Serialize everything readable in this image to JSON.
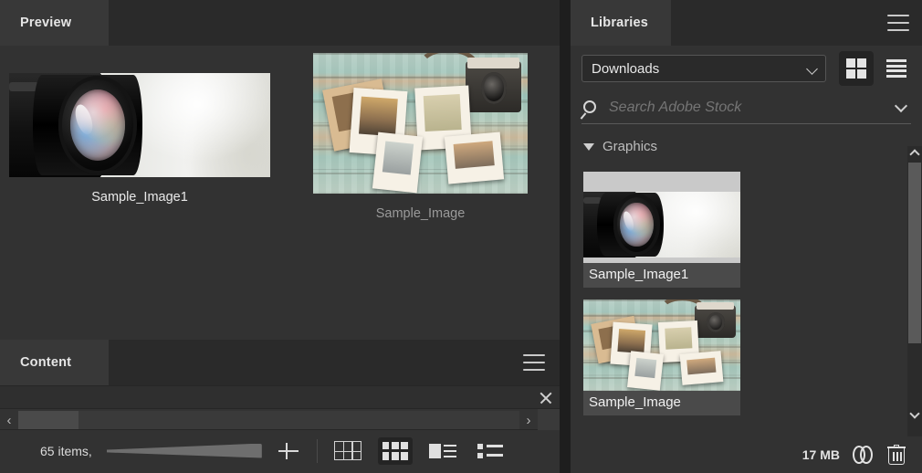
{
  "preview_panel": {
    "tab_label": "Preview",
    "menu_icon": "hamburger-menu-icon",
    "items": [
      {
        "caption": "Sample_Image1",
        "artwork": "camera-lens-photo"
      },
      {
        "caption": "Sample_Image",
        "artwork": "polaroid-photos-on-wood-photo"
      }
    ]
  },
  "content_panel": {
    "tab_label": "Content",
    "menu_icon": "hamburger-menu-icon",
    "close_icon": "close-icon",
    "scrollbar": {
      "left_arrow": "‹",
      "right_arrow": "›"
    },
    "toolbar": {
      "items_count": "65 items,",
      "zoom_slider_label": "thumbnail-size-slider",
      "plus_label": "increase-thumbnail-size",
      "view_buttons": [
        {
          "name": "grid-view",
          "active": false
        },
        {
          "name": "thumbnail-view",
          "active": true
        },
        {
          "name": "details-view",
          "active": false
        },
        {
          "name": "list-view",
          "active": false
        }
      ]
    }
  },
  "libraries_panel": {
    "tab_label": "Libraries",
    "menu_icon": "hamburger-menu-icon",
    "library_select": {
      "value": "Downloads",
      "chevron": "chevron-down-icon"
    },
    "view_modes": [
      {
        "name": "grid-view-mode",
        "active": true
      },
      {
        "name": "list-view-mode",
        "active": false
      }
    ],
    "search": {
      "placeholder": "Search Adobe Stock",
      "value": "",
      "icon": "search-icon",
      "chevron": "chevron-down-icon"
    },
    "group": {
      "title": "Graphics",
      "expanded": true,
      "disclosure_icon": "triangle-down-icon"
    },
    "assets": [
      {
        "label": "Sample_Image1",
        "artwork": "camera-lens-photo"
      },
      {
        "label": "Sample_Image",
        "artwork": "polaroid-photos-on-wood-photo"
      }
    ],
    "footer": {
      "size": "17 MB",
      "cc_icon": "creative-cloud-icon",
      "trash_icon": "trash-icon"
    }
  },
  "colors": {
    "panel_bg": "#323232",
    "tabstrip_bg": "#2a2a2a",
    "tab_active_bg": "#383838",
    "asset_bg": "#4a4a4a",
    "text": "#e6e6e6",
    "muted_text": "#bdbdbd"
  }
}
